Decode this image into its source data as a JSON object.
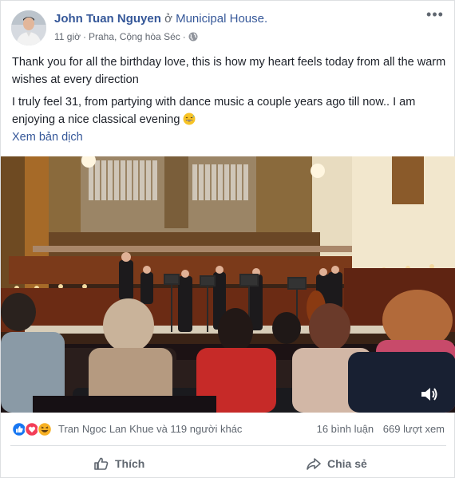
{
  "post": {
    "author_name": "John Tuan Nguyen",
    "at_word": "ở",
    "place": "Municipal House.",
    "time": "11 giờ",
    "location": "Praha, Cộng hòa Séc",
    "privacy_icon": "globe-icon",
    "menu_icon": "more-icon",
    "paragraphs": [
      "Thank you for all the birthday love, this is how my heart feels today from all the warm wishes at every direction",
      "I truly feel 31, from partying with dance music a couple years ago till now.. I am enjoying a nice classical evening"
    ],
    "paragraph_emoji": "grinning-sweat-emoji",
    "translate_label": "Xem bản dịch"
  },
  "video": {
    "description_icon": "volume-icon"
  },
  "reactions": {
    "icons": [
      "like-reaction-icon",
      "love-reaction-icon",
      "haha-reaction-icon"
    ],
    "summary": "Tran Ngoc Lan Khue và 119 người khác",
    "comments": "16 bình luận",
    "views": "669 lượt xem"
  },
  "actions": {
    "like_label": "Thích",
    "share_label": "Chia sẻ"
  },
  "colors": {
    "link": "#365899",
    "meta": "#616770",
    "like_blue": "#1877f2",
    "love_red": "#f33e58",
    "haha_yellow": "#f7b125"
  }
}
